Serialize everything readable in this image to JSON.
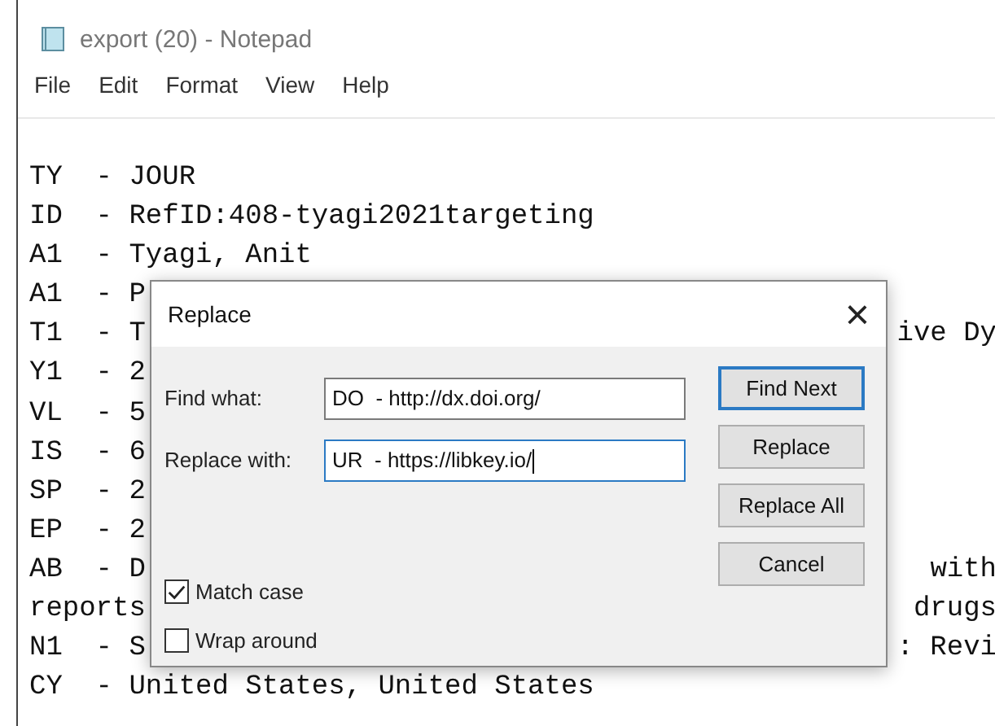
{
  "window": {
    "title": "export (20) - Notepad"
  },
  "menu": [
    "File",
    "Edit",
    "Format",
    "View",
    "Help"
  ],
  "editor": {
    "lines": [
      {
        "text": "TY  - JOUR"
      },
      {
        "text": "ID  - RefID:408-tyagi2021targeting"
      },
      {
        "text": "A1  - Tyagi, Anit"
      },
      {
        "text": "A1  - P"
      },
      {
        "text": "T1  - T",
        "tail": "ive Dy"
      },
      {
        "text": "Y1  - 2"
      },
      {
        "text": "VL  - 5"
      },
      {
        "text": "IS  - 6"
      },
      {
        "text": "SP  - 2"
      },
      {
        "text": "EP  - 2"
      },
      {
        "text": "AB  - D",
        "tail": "with"
      },
      {
        "text": "reports",
        "tail": "drugs"
      },
      {
        "text": "N1  - S",
        "tail": ": Revi"
      },
      {
        "text": "CY  - United States, United States"
      }
    ]
  },
  "dialog": {
    "title": "Replace",
    "close": "×",
    "fields": [
      {
        "label": "Find what:",
        "value": "DO  - http://dx.doi.org/",
        "focused": false
      },
      {
        "label": "Replace with:",
        "value": "UR  - https://libkey.io/",
        "focused": true
      }
    ],
    "buttons": [
      {
        "label": "Find Next",
        "default": true
      },
      {
        "label": "Replace",
        "default": false
      },
      {
        "label": "Replace All",
        "default": false
      },
      {
        "label": "Cancel",
        "default": false
      }
    ],
    "options": [
      {
        "label": "Match case",
        "checked": true
      },
      {
        "label": "Wrap around",
        "checked": false
      }
    ]
  }
}
